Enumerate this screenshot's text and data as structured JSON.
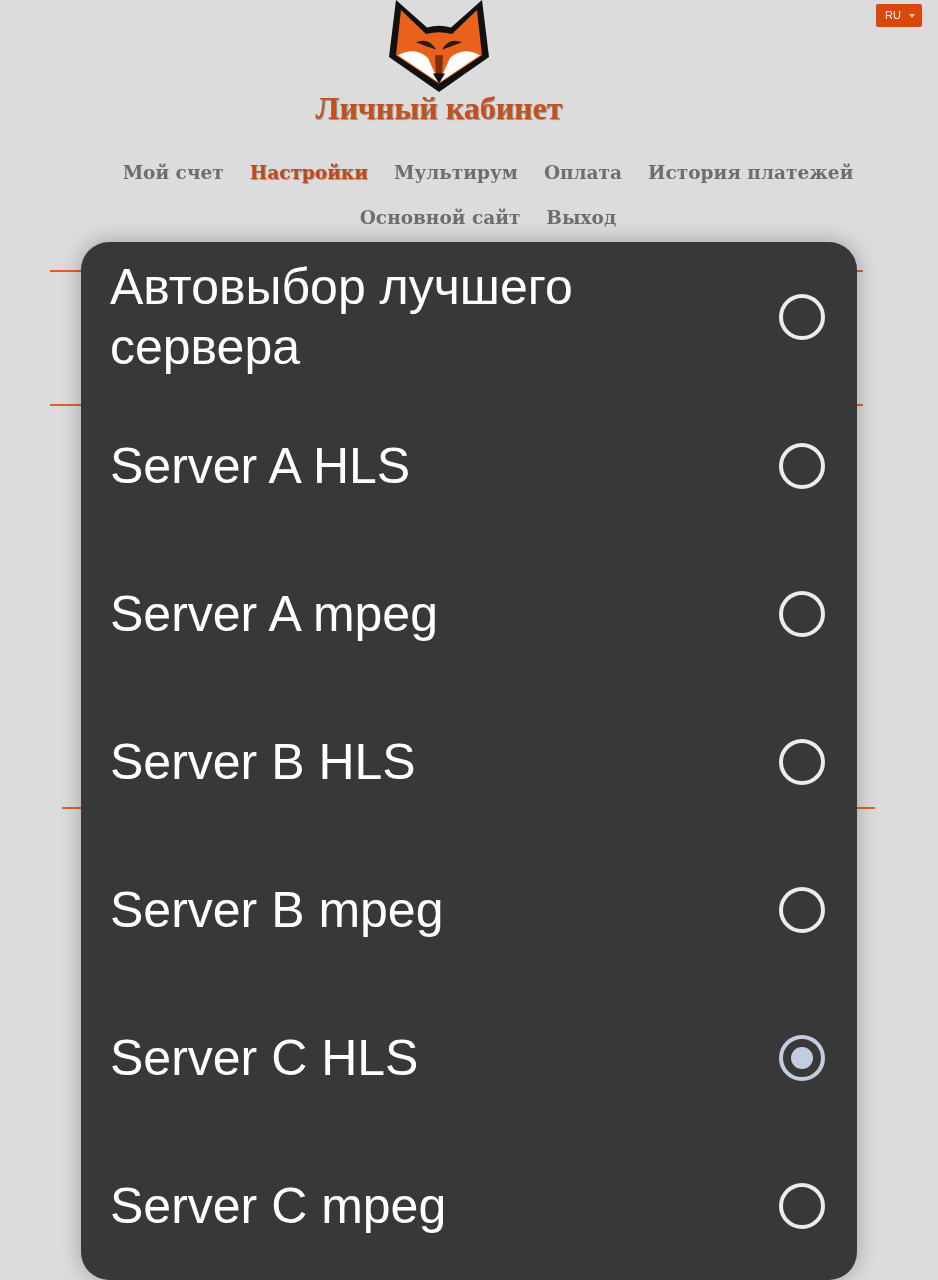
{
  "language_button": {
    "label": "RU"
  },
  "header": {
    "title": "Личный кабинет"
  },
  "nav": [
    {
      "label": "Мой счет",
      "selected": false
    },
    {
      "label": "Настройки",
      "selected": true
    },
    {
      "label": "Мультирум",
      "selected": false
    },
    {
      "label": "Оплата",
      "selected": false
    },
    {
      "label": "История платежей",
      "selected": false
    },
    {
      "label": "Основной сайт",
      "selected": false
    },
    {
      "label": "Выход",
      "selected": false
    }
  ],
  "dialog": {
    "options": [
      {
        "label": "Автовыбор лучшего сервера",
        "selected": false
      },
      {
        "label": "Server A HLS",
        "selected": false
      },
      {
        "label": "Server A mpeg",
        "selected": false
      },
      {
        "label": "Server B HLS",
        "selected": false
      },
      {
        "label": "Server B mpeg",
        "selected": false
      },
      {
        "label": "Server C HLS",
        "selected": true
      },
      {
        "label": "Server C mpeg",
        "selected": false
      }
    ]
  }
}
